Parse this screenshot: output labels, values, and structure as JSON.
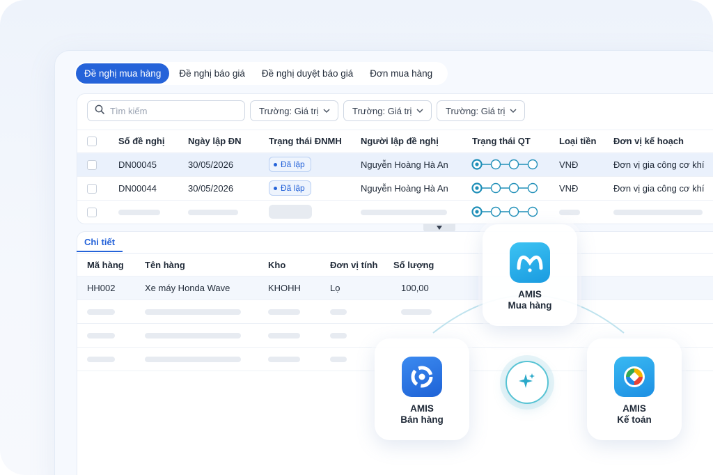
{
  "tabs": [
    {
      "label": "Đề nghị mua hàng",
      "active": true
    },
    {
      "label": "Đề nghị báo giá",
      "active": false
    },
    {
      "label": "Đề nghị duyệt báo giá",
      "active": false
    },
    {
      "label": "Đơn mua hàng",
      "active": false
    }
  ],
  "search": {
    "placeholder": "Tìm kiếm"
  },
  "filters": [
    {
      "field": "Trường:",
      "value": "Giá trị"
    },
    {
      "field": "Trường:",
      "value": "Giá trị"
    },
    {
      "field": "Trường:",
      "value": "Giá trị"
    }
  ],
  "table": {
    "columns": [
      "Số đề nghị",
      "Ngày lập ĐN",
      "Trạng thái ĐNMH",
      "Người lập đề nghị",
      "Trạng thái QT",
      "Loại tiền",
      "Đơn vị kế hoạch"
    ],
    "rows": [
      {
        "so": "DN00045",
        "ngay": "30/05/2026",
        "trang_thai": "Đã lập",
        "nguoi_lap": "Nguyễn Hoàng Hà An",
        "loai_tien": "VNĐ",
        "don_vi": "Đơn vị gia công cơ khí"
      },
      {
        "so": "DN00044",
        "ngay": "30/05/2026",
        "trang_thai": "Đã lập",
        "nguoi_lap": "Nguyễn Hoàng Hà An",
        "loai_tien": "VNĐ",
        "don_vi": "Đơn vị gia công cơ khí"
      }
    ]
  },
  "detail": {
    "tab": "Chi tiết",
    "columns": [
      "Mã hàng",
      "Tên hàng",
      "Kho",
      "Đơn vị tính",
      "Số lượng"
    ],
    "rows": [
      {
        "ma": "HH002",
        "ten": "Xe máy Honda Wave",
        "kho": "KHOHH",
        "dvt": "Lọ",
        "sl": "100,00"
      }
    ]
  },
  "apps": {
    "mua_hang": {
      "line1": "AMIS",
      "line2": "Mua hàng"
    },
    "ban_hang": {
      "line1": "AMIS",
      "line2": "Bán hàng"
    },
    "ke_toan": {
      "line1": "AMIS",
      "line2": "Kế toán"
    }
  },
  "colors": {
    "primary": "#2563d9",
    "hub_ring": "#57c3d4",
    "mua_hang_icon": "#1aa8e8",
    "ban_hang_icon": "#1f6fe0"
  },
  "icons": [
    "search-icon",
    "chevron-down-icon",
    "caret-down-icon",
    "sparkle-icon",
    "amis-mua-hang-icon",
    "amis-ban-hang-icon",
    "amis-ke-toan-icon"
  ]
}
